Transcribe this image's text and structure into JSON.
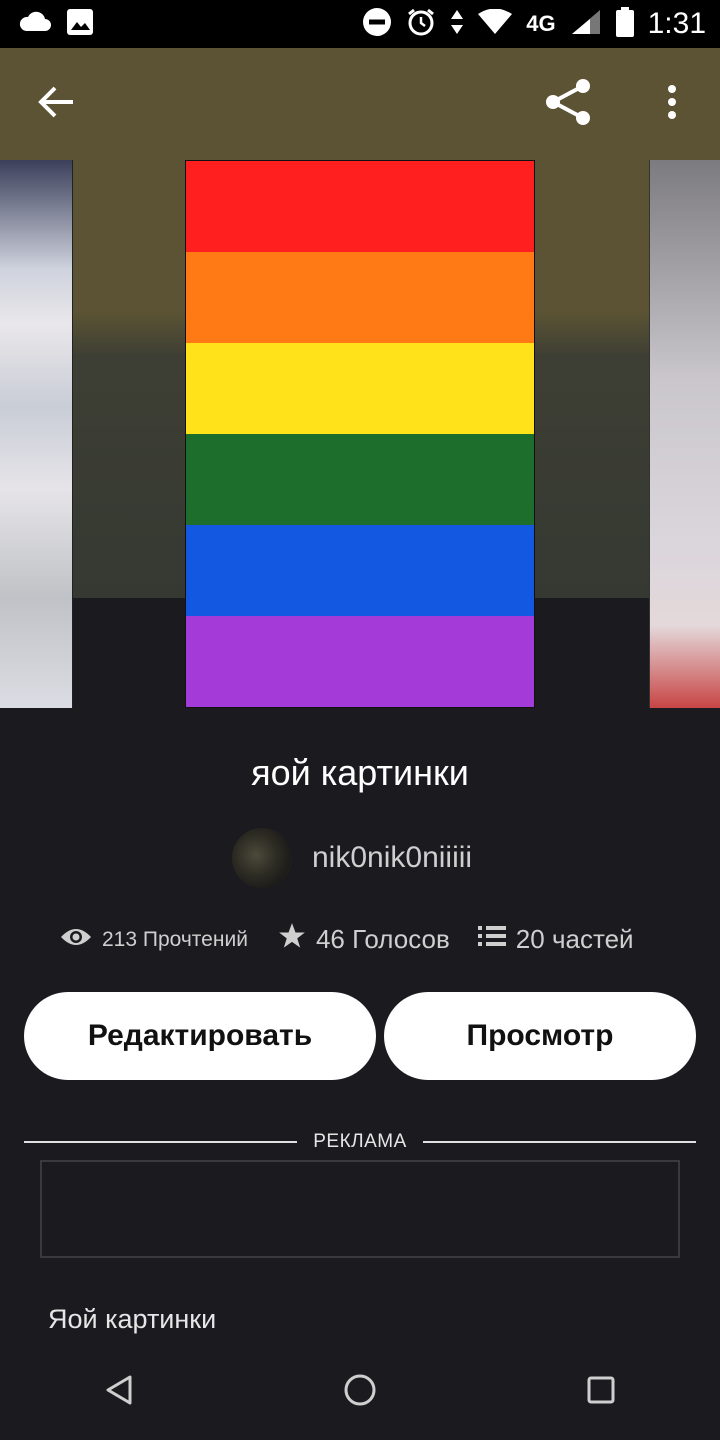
{
  "status_bar": {
    "time": "1:31",
    "network": "4G",
    "icons": [
      "cloud-icon",
      "image-icon",
      "dnd-icon",
      "alarm-icon",
      "data-arrows-icon",
      "wifi-icon",
      "signal-icon",
      "battery-icon"
    ]
  },
  "toolbar": {
    "back_icon": "arrow-left-icon",
    "share_icon": "share-icon",
    "more_icon": "more-vertical-icon"
  },
  "cover": {
    "stripes": [
      "#ff1f1f",
      "#ff7a14",
      "#ffe21a",
      "#1d6e2c",
      "#1258e0",
      "#a43ad8"
    ]
  },
  "story": {
    "title": "яой картинки",
    "author": "nik0nik0niiiii",
    "reads": "213 Прочтений",
    "votes": "46 Голосов",
    "parts": "20 частей",
    "description": "Яой картинки"
  },
  "actions": {
    "edit_label": "Редактировать",
    "view_label": "Просмотр"
  },
  "ad": {
    "label": "РЕКЛАМА"
  },
  "nav": {
    "icons": [
      "nav-back-icon",
      "nav-home-icon",
      "nav-recents-icon"
    ]
  }
}
